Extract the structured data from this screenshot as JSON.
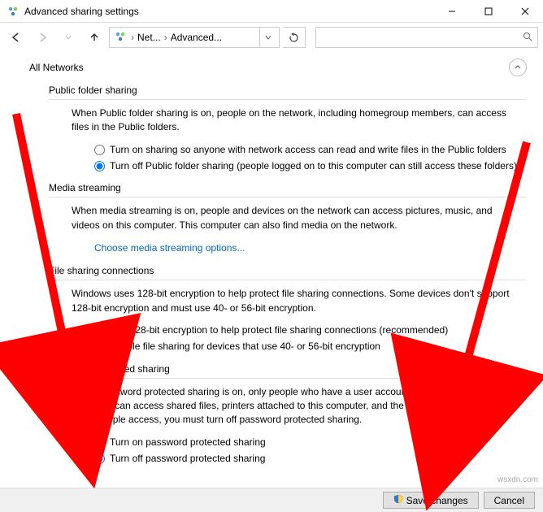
{
  "window": {
    "title": "Advanced sharing settings"
  },
  "nav": {
    "crumb1": "Net...",
    "crumb2": "Advanced...",
    "search_placeholder": ""
  },
  "profile": {
    "label": "All Networks"
  },
  "public_folder": {
    "heading": "Public folder sharing",
    "desc": "When Public folder sharing is on, people on the network, including homegroup members, can access files in the Public folders.",
    "opt_on": "Turn on sharing so anyone with network access can read and write files in the Public folders",
    "opt_off": "Turn off Public folder sharing (people logged on to this computer can still access these folders)",
    "selected": "off"
  },
  "media": {
    "heading": "Media streaming",
    "desc": "When media streaming is on, people and devices on the network can access pictures, music, and videos on this computer. This computer can also find media on the network.",
    "link": "Choose media streaming options..."
  },
  "file_sharing": {
    "heading": "File sharing connections",
    "desc": "Windows uses 128-bit encryption to help protect file sharing connections. Some devices don't support 128-bit encryption and must use 40- or 56-bit encryption.",
    "opt_128": "Use 128-bit encryption to help protect file sharing connections (recommended)",
    "opt_40": "Enable file sharing for devices that use 40- or 56-bit encryption",
    "selected": "128"
  },
  "password": {
    "heading": "Password protected sharing",
    "desc": "When password protected sharing is on, only people who have a user account and password on this computer can access shared files, printers attached to this computer, and the Public folders. To give other people access, you must turn off password protected sharing.",
    "opt_on": "Turn on password protected sharing",
    "opt_off": "Turn off password protected sharing",
    "selected": "off"
  },
  "buttons": {
    "save": "Save changes",
    "cancel": "Cancel"
  },
  "watermark": "wsxdn.com"
}
